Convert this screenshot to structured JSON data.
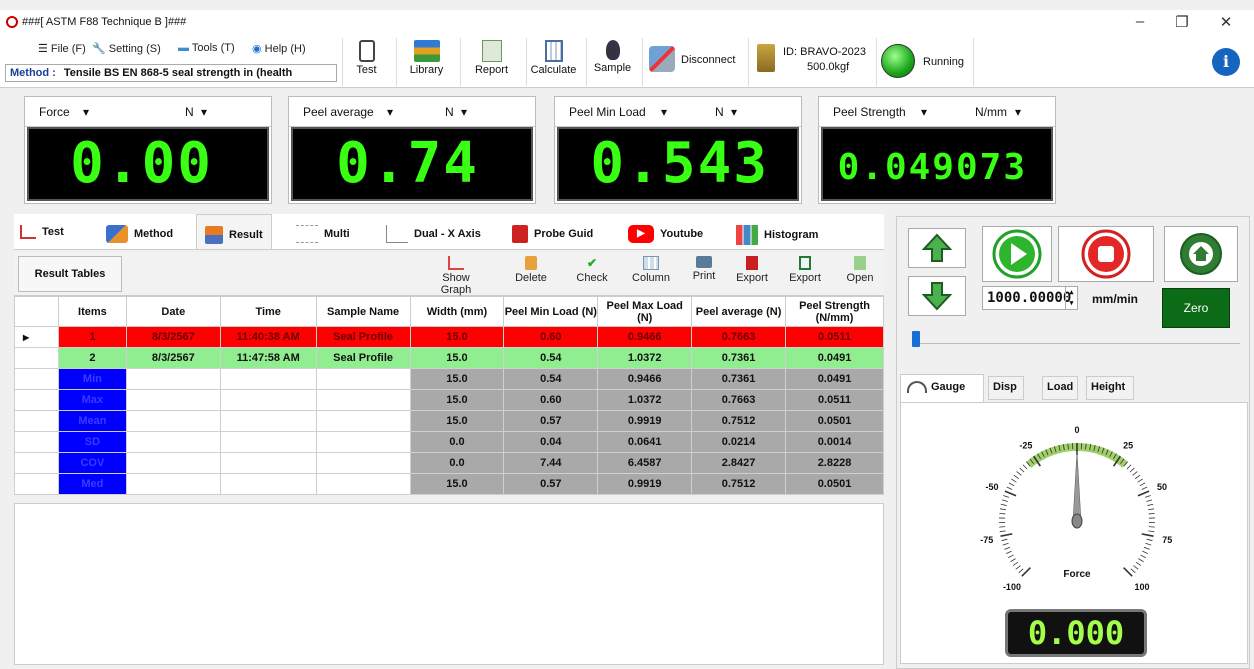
{
  "window": {
    "title": "###[ ASTM F88 Technique B ]###",
    "minimize": "–",
    "restore": "❐",
    "close": "✕"
  },
  "menu": {
    "file": "File (F)",
    "setting": "Setting (S)",
    "tools": "Tools (T)",
    "help": "Help (H)"
  },
  "method": {
    "label": "Method :",
    "value": "Tensile  BS EN 868-5 seal strength in (health"
  },
  "toolbar": {
    "test": "Test",
    "library": "Library",
    "report": "Report",
    "calculate": "Calculate",
    "sample": "Sample",
    "disconnect": "Disconnect",
    "device_id": "ID: BRAVO-2023",
    "capacity": "500.0kgf",
    "status": "Running"
  },
  "readouts": [
    {
      "name": "Force",
      "unit": "N",
      "value": "0.00"
    },
    {
      "name": "Peel average",
      "unit": "N",
      "value": "0.74"
    },
    {
      "name": "Peel Min Load",
      "unit": "N",
      "value": "0.543"
    },
    {
      "name": "Peel Strength",
      "unit": "N/mm",
      "value": "0.049073"
    }
  ],
  "tabs": [
    "Test",
    "Method",
    "Result",
    "Multi",
    "Dual - X Axis",
    "Probe Guid",
    "Youtube",
    "Histogram"
  ],
  "result": {
    "title": "Result Tables",
    "actions": [
      "Show Graph",
      "Delete",
      "Check",
      "Column",
      "Print",
      "Export",
      "Export",
      "Open"
    ],
    "columns": [
      "Items",
      "Date",
      "Time",
      "Sample Name",
      "Width (mm)",
      "Peel Min Load (N)",
      "Peel Max Load (N)",
      "Peel average (N)",
      "Peel Strength (N/mm)"
    ],
    "rows": [
      [
        "1",
        "8/3/2567",
        "11:40:38 AM",
        "Seal Profile",
        "15.0",
        "0.60",
        "0.9466",
        "0.7663",
        "0.0511"
      ],
      [
        "2",
        "8/3/2567",
        "11:47:58 AM",
        "Seal Profile",
        "15.0",
        "0.54",
        "1.0372",
        "0.7361",
        "0.0491"
      ]
    ],
    "stats": [
      [
        "Min",
        "15.0",
        "0.54",
        "0.9466",
        "0.7361",
        "0.0491"
      ],
      [
        "Max",
        "15.0",
        "0.60",
        "1.0372",
        "0.7663",
        "0.0511"
      ],
      [
        "Mean",
        "15.0",
        "0.57",
        "0.9919",
        "0.7512",
        "0.0501"
      ],
      [
        "SD",
        "0.0",
        "0.04",
        "0.0641",
        "0.0214",
        "0.0014"
      ],
      [
        "COV",
        "0.0",
        "7.44",
        "6.4587",
        "2.8427",
        "2.8228"
      ],
      [
        "Med",
        "15.0",
        "0.57",
        "0.9919",
        "0.7512",
        "0.0501"
      ]
    ]
  },
  "control": {
    "speed": "1000.00000",
    "speed_unit": "mm/min",
    "zero": "Zero"
  },
  "gauge": {
    "tabs": [
      "Gauge",
      "Disp",
      "Load",
      "Height"
    ],
    "label": "Force",
    "ticks": [
      "-100",
      "-75",
      "-50",
      "-25",
      "0",
      "25",
      "50",
      "75",
      "100"
    ],
    "value": "0.000",
    "needle": 0
  },
  "colors": {
    "lcd_green": "#39ff14",
    "row_red": "#fe0000",
    "row_green": "#90ee90",
    "stat_blue": "#0000ff",
    "zero_green": "#0b6b16"
  }
}
